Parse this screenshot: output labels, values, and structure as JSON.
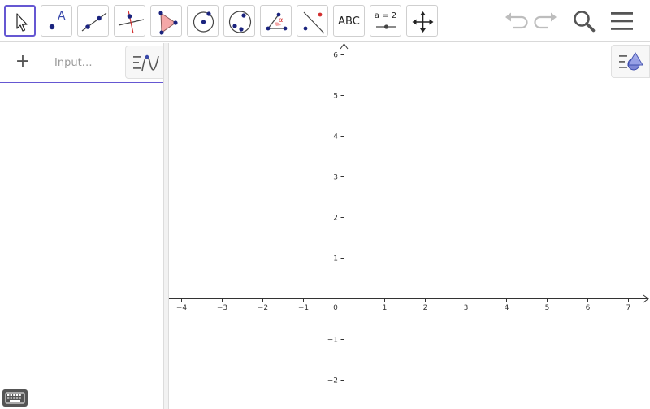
{
  "toolbar": {
    "tools": [
      {
        "name": "move-tool",
        "icon": "arrow-pointer-icon"
      },
      {
        "name": "point-tool",
        "icon": "point-a-icon",
        "label": "A"
      },
      {
        "name": "line-tool",
        "icon": "line-through-two-points-icon"
      },
      {
        "name": "perpendicular-line-tool",
        "icon": "perpendicular-line-icon"
      },
      {
        "name": "polygon-tool",
        "icon": "polygon-icon"
      },
      {
        "name": "circle-tool",
        "icon": "circle-center-point-icon"
      },
      {
        "name": "circle-three-points-tool",
        "icon": "circle-three-points-icon"
      },
      {
        "name": "angle-tool",
        "icon": "angle-icon",
        "label": "α"
      },
      {
        "name": "reflect-tool",
        "icon": "reflect-about-line-icon"
      },
      {
        "name": "text-tool",
        "icon": "text-icon",
        "label": "ABC"
      },
      {
        "name": "slider-tool",
        "icon": "slider-icon",
        "label": "a = 2"
      },
      {
        "name": "move-graphics-tool",
        "icon": "move-graphics-view-icon"
      }
    ],
    "undo_icon": "undo-icon",
    "redo_icon": "redo-icon",
    "search_icon": "search-icon",
    "menu_icon": "hamburger-menu-icon"
  },
  "algebra": {
    "add_label": "+",
    "input_placeholder": "Input…",
    "style_icon": "algebra-style-icon"
  },
  "graphics": {
    "style_icon": "graphics-style-icon",
    "x_ticks": [
      "−4",
      "−3",
      "−2",
      "−1",
      "0",
      "1",
      "2",
      "3",
      "4",
      "5",
      "6",
      "7"
    ],
    "y_ticks": [
      "6",
      "5",
      "4",
      "3",
      "2",
      "1",
      "−1",
      "−2"
    ]
  },
  "colors": {
    "accent": "#6557d2",
    "point": "#1a237e",
    "polygon_fill": "#f4a7a7",
    "red": "#d32f2f"
  },
  "keyboard_icon": "keyboard-icon"
}
